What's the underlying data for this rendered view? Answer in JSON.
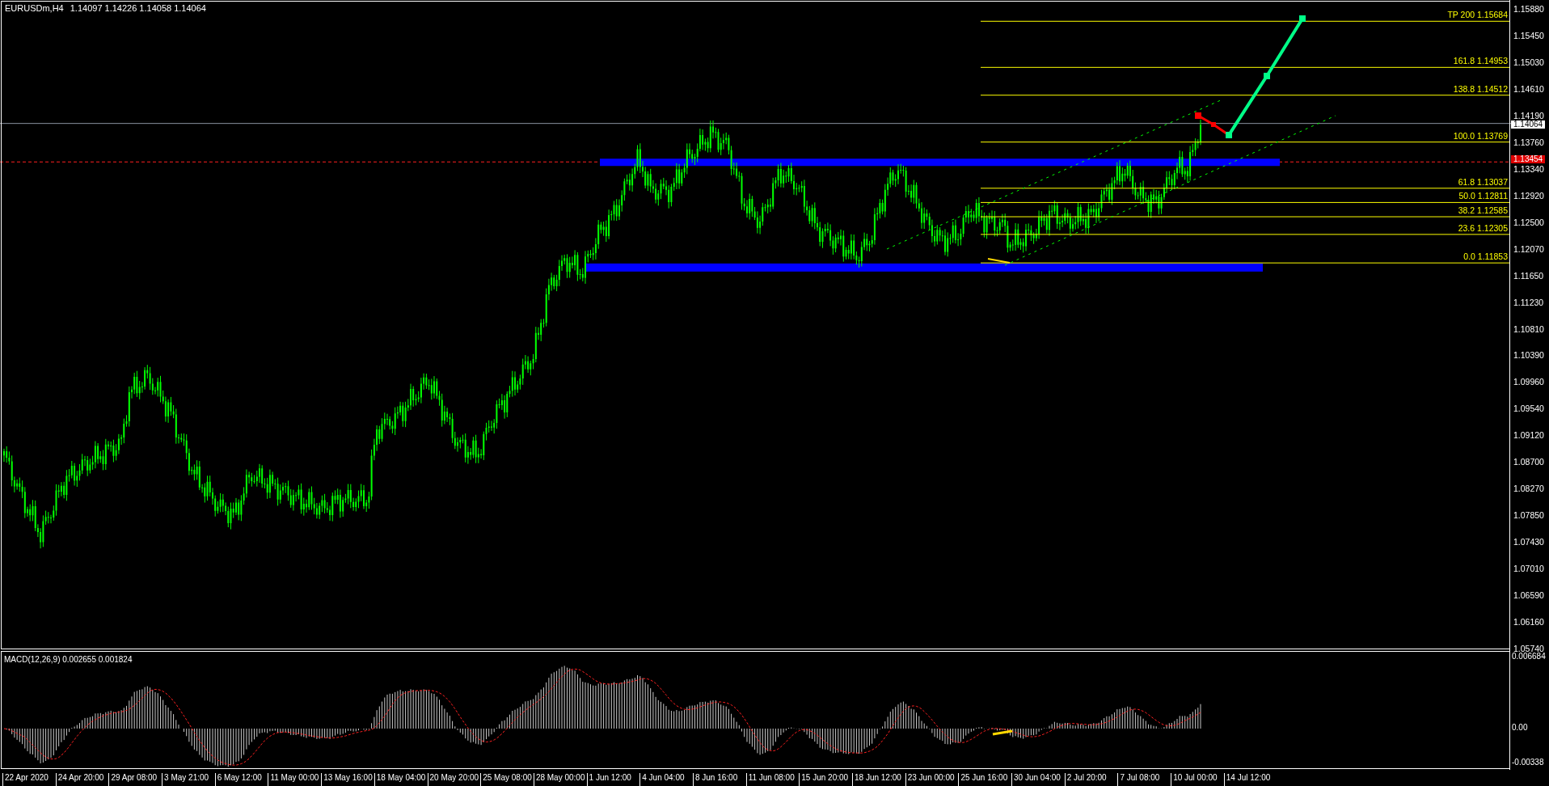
{
  "header": {
    "symbol": "EURUSDm,H4",
    "ohlc": "1.14097 1.14226 1.14058 1.14064"
  },
  "price_axis": {
    "ticks": [
      "1.15880",
      "1.15450",
      "1.15030",
      "1.14610",
      "1.14190",
      "1.13760",
      "1.13340",
      "1.12920",
      "1.12500",
      "1.12070",
      "1.11650",
      "1.11230",
      "1.10810",
      "1.10390",
      "1.09960",
      "1.09540",
      "1.09120",
      "1.08700",
      "1.08270",
      "1.07850",
      "1.07430",
      "1.07010",
      "1.06590",
      "1.06160",
      "1.05740"
    ],
    "bid_label": "1.14064",
    "line_label": "1.13454"
  },
  "fibonacci": {
    "levels": [
      {
        "label": "TP 200 1.15684"
      },
      {
        "label": "161.8 1.14953"
      },
      {
        "label": "138.8 1.14512"
      },
      {
        "label": "100.0 1.13769"
      },
      {
        "label": "61.8 1.13037"
      },
      {
        "label": "50.0 1.12811"
      },
      {
        "label": "38.2 1.12585"
      },
      {
        "label": "23.6 1.12305"
      },
      {
        "label": "0.0 1.11853"
      }
    ]
  },
  "macd": {
    "title": "MACD(12,26,9) 0.002655 0.001824",
    "axis": [
      "0.006684",
      "0.00",
      "-0.00338"
    ]
  },
  "time_axis": {
    "labels": [
      "22 Apr 2020",
      "24 Apr 20:00",
      "29 Apr 08:00",
      "3 May 21:00",
      "6 May 12:00",
      "11 May 00:00",
      "13 May 16:00",
      "18 May 04:00",
      "20 May 20:00",
      "25 May 08:00",
      "28 May 00:00",
      "1 Jun 12:00",
      "4 Jun 04:00",
      "8 Jun 16:00",
      "11 Jun 08:00",
      "15 Jun 20:00",
      "18 Jun 12:00",
      "23 Jun 00:00",
      "25 Jun 16:00",
      "30 Jun 04:00",
      "2 Jul 20:00",
      "7 Jul 08:00",
      "10 Jul 00:00",
      "14 Jul 12:00"
    ]
  }
}
